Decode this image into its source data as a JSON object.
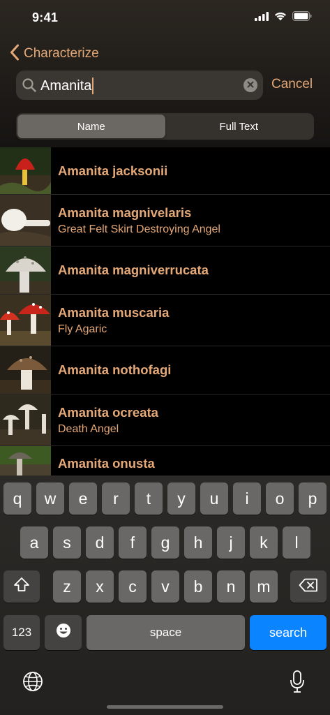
{
  "status_bar": {
    "time": "9:41"
  },
  "nav": {
    "back_label": "Characterize"
  },
  "search": {
    "value": "Amanita",
    "cancel_label": "Cancel"
  },
  "segments": [
    {
      "label": "Name",
      "selected": true
    },
    {
      "label": "Full Text",
      "selected": false
    }
  ],
  "results": [
    {
      "name": "Amanita jacksonii",
      "common": "",
      "thumb_colors": [
        "#1d2b15",
        "#c8201a"
      ]
    },
    {
      "name": "Amanita magnivelaris",
      "common": "Great Felt Skirt Destroying Angel",
      "thumb_colors": [
        "#3a3024",
        "#e9e4dc"
      ]
    },
    {
      "name": "Amanita magniverrucata",
      "common": "",
      "thumb_colors": [
        "#2d3a22",
        "#dcd6ce"
      ]
    },
    {
      "name": "Amanita muscaria",
      "common": "Fly Agaric",
      "thumb_colors": [
        "#3b3120",
        "#c8261b"
      ]
    },
    {
      "name": "Amanita nothofagi",
      "common": "",
      "thumb_colors": [
        "#241f17",
        "#7a5a3a"
      ]
    },
    {
      "name": "Amanita ocreata",
      "common": "Death Angel",
      "thumb_colors": [
        "#2f2a1e",
        "#e3ddd3"
      ]
    },
    {
      "name": "Amanita onusta",
      "common": "",
      "thumb_colors": [
        "#3c5a22",
        "#6b6458"
      ]
    }
  ],
  "keyboard": {
    "row1": [
      "q",
      "w",
      "e",
      "r",
      "t",
      "y",
      "u",
      "i",
      "o",
      "p"
    ],
    "row2": [
      "a",
      "s",
      "d",
      "f",
      "g",
      "h",
      "j",
      "k",
      "l"
    ],
    "row3": [
      "z",
      "x",
      "c",
      "v",
      "b",
      "n",
      "m"
    ],
    "numbers_label": "123",
    "space_label": "space",
    "search_label": "search"
  },
  "colors": {
    "accent": "#e5a877",
    "search_key": "#0a84ff"
  }
}
